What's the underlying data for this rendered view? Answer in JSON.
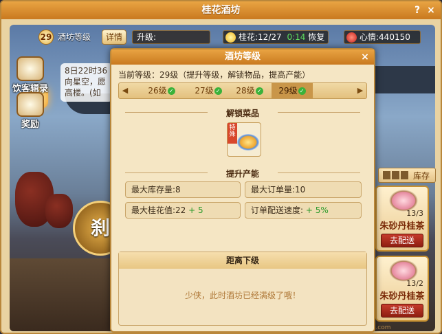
{
  "window": {
    "title": "桂花酒坊",
    "help": "?",
    "close": "×"
  },
  "topbar": {
    "level_value": "29",
    "level_label": "酒坊等级",
    "detail_button": "详情",
    "upgrade_label": "升级:",
    "osmanthus": "桂花:12/27",
    "timer": "0:14",
    "recover": "恢复",
    "mood": "心情:440150"
  },
  "side": {
    "recipe_label": "饮客辑录",
    "reward_label": "奖励",
    "notice_lines": [
      "8日22时36",
      "向星空，愿",
      "高楼。(如"
    ]
  },
  "big_button": "刹",
  "storage": {
    "label": "库存"
  },
  "cards": [
    {
      "name": "朱砂丹桂茶",
      "count": "13/3",
      "button": "去配送"
    },
    {
      "name": "朱砂丹桂茶",
      "count": "13/2",
      "button": "去配送"
    }
  ],
  "watermark": "xyq.163.com",
  "modal": {
    "title": "酒坊等级",
    "close": "×",
    "current": "当前等级：29级（提升等级，解锁物品，提高产能）",
    "left_arrow": "◀",
    "right_arrow": "▶",
    "levels": [
      {
        "label": "26级",
        "done": true
      },
      {
        "label": "27级",
        "done": true
      },
      {
        "label": "28级",
        "done": true
      },
      {
        "label": "29级",
        "done": true
      }
    ],
    "unlock_title": "解锁菜品",
    "unlock_ribbon": "特殊",
    "capacity_title": "提升产能",
    "stats": {
      "max_stock": "最大库存量:8",
      "max_order": "最大订单量:10",
      "max_osmanthus": "最大桂花值:22",
      "max_osmanthus_inc": "+ 5",
      "delivery_speed": "订单配送速度:",
      "delivery_speed_inc": "+ 5%"
    },
    "next_title": "距离下级",
    "next_message": "少侠，此时酒坊已经满级了哦！"
  },
  "colors": {
    "accent": "#c9791f",
    "increase": "#2a9a2a",
    "frame": "#b9873b"
  }
}
